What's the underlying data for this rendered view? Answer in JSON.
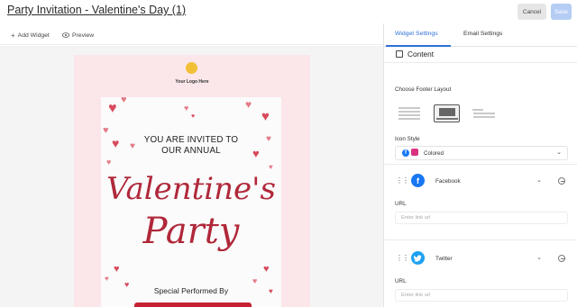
{
  "header": {
    "title": "Party Invitation - Valentine's Day (1)",
    "cancel_label": "Cancel",
    "save_label": "Save"
  },
  "toolbar": {
    "add_widget_label": "Add Widget",
    "preview_label": "Preview"
  },
  "canvas": {
    "logo_text": "Your Logo Here",
    "invite_line_1": "YOU ARE INVITED TO",
    "invite_line_2": "OUR ANNUAL",
    "script_line_1": "Valentine's",
    "script_line_2": "Party",
    "performed_by": "Special Performed By"
  },
  "panel": {
    "tabs": [
      {
        "label": "Widget Settings",
        "active": true
      },
      {
        "label": "Email Settings",
        "active": false
      }
    ],
    "section_title": "Content",
    "footer_layout_label": "Choose Footer Layout",
    "icon_style_label": "Icon Style",
    "icon_style_value": "Colored",
    "socials": [
      {
        "network": "Facebook",
        "url_label": "URL",
        "url_placeholder": "Enter link url"
      },
      {
        "network": "Twitter",
        "url_label": "URL",
        "url_placeholder": "Enter link url"
      }
    ]
  },
  "colors": {
    "accent": "#2d6fd6",
    "save_button": "#b5cdf5",
    "card_pink": "#fbe6e9",
    "heart_red": "#d84a5c",
    "script_red": "#b0283a",
    "facebook": "#1877f2",
    "twitter": "#1da1f2"
  }
}
